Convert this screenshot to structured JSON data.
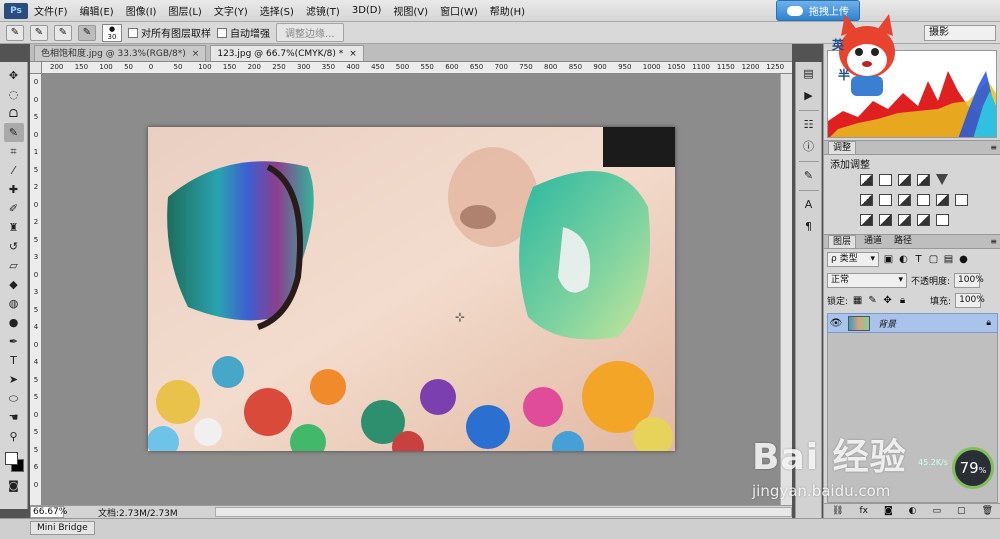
{
  "menu": {
    "logo": "Ps",
    "items": [
      "文件(F)",
      "编辑(E)",
      "图像(I)",
      "图层(L)",
      "文字(Y)",
      "选择(S)",
      "滤镜(T)",
      "3D(D)",
      "视图(V)",
      "窗口(W)",
      "帮助(H)"
    ],
    "upload_button": "拖拽上传"
  },
  "options": {
    "brush_size": "30",
    "sample_all_layers": "对所有图层取样",
    "auto_enhance": "自动增强",
    "refine_edge": "调整边缘...",
    "workspace": "摄影"
  },
  "tabs": [
    {
      "label": "色相饱和度.jpg @ 33.3%(RGB/8*)",
      "close": "×",
      "active": false
    },
    {
      "label": "123.jpg @ 66.7%(CMYK/8) *",
      "close": "×",
      "active": true
    }
  ],
  "ruler_h": [
    "200",
    "150",
    "100",
    "50",
    "0",
    "50",
    "100",
    "150",
    "200",
    "250",
    "300",
    "350",
    "400",
    "450",
    "500",
    "550",
    "600",
    "650",
    "700",
    "750",
    "800",
    "850",
    "900",
    "950",
    "1000",
    "1050",
    "1100",
    "1150",
    "1200",
    "1250"
  ],
  "ruler_v": [
    "0",
    "0",
    "5",
    "0",
    "1",
    "5",
    "2",
    "0",
    "2",
    "5",
    "3",
    "0",
    "3",
    "5",
    "4",
    "0",
    "4",
    "5",
    "5",
    "0",
    "5",
    "5",
    "6",
    "0"
  ],
  "tools": [
    {
      "name": "move-tool-icon",
      "glyph": "✥"
    },
    {
      "name": "marquee-tool-icon",
      "glyph": "◌"
    },
    {
      "name": "lasso-tool-icon",
      "glyph": "ᗝ"
    },
    {
      "name": "quick-selection-tool-icon",
      "glyph": "✎"
    },
    {
      "name": "crop-tool-icon",
      "glyph": "⌗"
    },
    {
      "name": "eyedropper-tool-icon",
      "glyph": "⁄"
    },
    {
      "name": "healing-brush-tool-icon",
      "glyph": "✚"
    },
    {
      "name": "brush-tool-icon",
      "glyph": "✐"
    },
    {
      "name": "clone-stamp-tool-icon",
      "glyph": "♜"
    },
    {
      "name": "history-brush-tool-icon",
      "glyph": "↺"
    },
    {
      "name": "eraser-tool-icon",
      "glyph": "▱"
    },
    {
      "name": "paint-bucket-tool-icon",
      "glyph": "◆"
    },
    {
      "name": "blur-tool-icon",
      "glyph": "◍"
    },
    {
      "name": "dodge-tool-icon",
      "glyph": "●"
    },
    {
      "name": "pen-tool-icon",
      "glyph": "✒"
    },
    {
      "name": "type-tool-icon",
      "glyph": "T"
    },
    {
      "name": "path-selection-tool-icon",
      "glyph": "➤"
    },
    {
      "name": "ellipse-tool-icon",
      "glyph": "⬭"
    },
    {
      "name": "hand-tool-icon",
      "glyph": "☚"
    },
    {
      "name": "zoom-tool-icon",
      "glyph": "⚲"
    }
  ],
  "status": {
    "zoom": "66.67%",
    "doc_size": "文档:2.73M/2.73M"
  },
  "mini_bridge": "Mini Bridge",
  "adjustments": {
    "tab": "调整",
    "title": "添加调整"
  },
  "layers": {
    "tabs": [
      "图层",
      "通道",
      "路径"
    ],
    "filter_kind": "ρ 类型",
    "blend_mode": "正常",
    "opacity_label": "不透明度:",
    "opacity_value": "100%",
    "lock_label": "锁定:",
    "fill_label": "填充:",
    "fill_value": "100%",
    "layer_name": "背景"
  },
  "mascot": {
    "left_char": "英",
    "right_char": "半"
  },
  "watermark": {
    "brand": "Bai 经验",
    "url": "jingyan.baidu.com"
  },
  "perf": {
    "value": "79",
    "unit": "%",
    "side": "45.2K/s"
  },
  "colors": {
    "canvas_bg": "#8c8c8c",
    "panel_bg": "#d6d6d6",
    "selected_layer": "#a9c3ea",
    "upload_blue": "#2d83cf"
  }
}
